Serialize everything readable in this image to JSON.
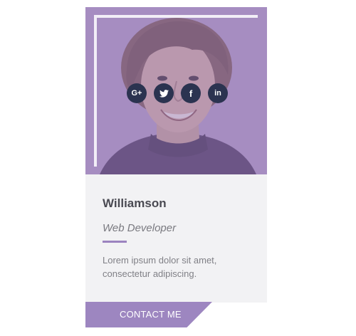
{
  "profile": {
    "name": "Williamson",
    "role": "Web Developer",
    "description": "Lorem ipsum dolor sit amet, consectetur adipiscing."
  },
  "socials": [
    {
      "label": "G+",
      "icon": "google-plus-icon"
    },
    {
      "label": "",
      "icon": "twitter-icon"
    },
    {
      "label": "f",
      "icon": "facebook-icon"
    },
    {
      "label": "in",
      "icon": "linkedin-icon"
    }
  ],
  "cta": {
    "label": "CONTACT ME"
  },
  "colors": {
    "accent": "#9d86c0",
    "overlay": "#a58fbe",
    "social_bg": "#2b3350",
    "card_bg": "#f2f2f4"
  }
}
